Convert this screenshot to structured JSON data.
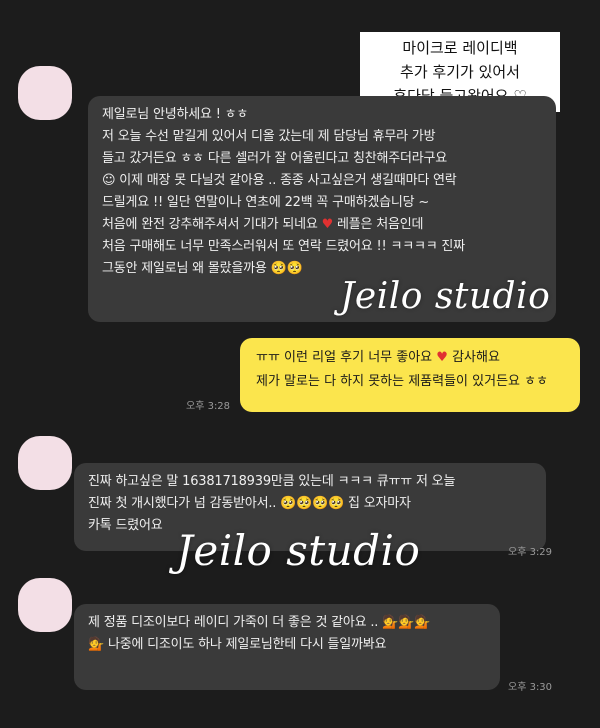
{
  "note": {
    "line1": "마이크로 레이디백",
    "line2": "추가 후기가 있어서",
    "line3": "후다닥 들고왔어요 ♡"
  },
  "watermark": "Jeilo studio",
  "messages": {
    "m1": {
      "line1": "제일로님 안녕하세요 ! ㅎㅎ",
      "line2": "저 오늘 수선 맡길게 있어서 디올 갔는데 제 담당님 휴무라 가방",
      "line3": "들고 갔거든요 ㅎㅎ 다른 셀러가 잘 어울린다고 칭찬해주더라구요",
      "line4": "☺ 이제 매장 못 다닐것 같아용 .. 종종 사고싶은거 생길때마다 연락",
      "line5": "드릴게요 !! 일단 연말이나 연초에 22백 꼭 구매하겠습니당 ~",
      "line6a": "처음에 완전 강추해주셔서 기대가 되네요",
      "line6b": "레플은 처음인데",
      "line7": "처음 구매해도 너무 만족스러워서 또 연락 드렸어요 !! ㅋㅋㅋㅋ 진짜",
      "line8": "그동안 제일로님 왜 몰랐을까용 🥺🥺",
      "time": "오후 3:28"
    },
    "m2": {
      "line1a": "ㅠㅠ 이런 리얼 후기 너무 좋아요",
      "line1b": "감사해요",
      "line2": "제가 말로는 다 하지 못하는 제품력들이 있거든요 ㅎㅎ",
      "time": "오후 3:28"
    },
    "m3": {
      "line1": "진짜 하고싶은 말 16381718939만큼 있는데 ㅋㅋㅋ 큐ㅠㅠ 저 오늘",
      "line2": "진짜 첫 개시했다가 넘 감동받아서.. 🥺🥺🥺🥺 집 오자마자",
      "line3": "카톡 드렸어요",
      "time": "오후 3:29"
    },
    "m4": {
      "line1": "제 정품 디조이보다 레이디 가죽이 더 좋은 것 같아요 ..",
      "line2": "나중에 디조이도 하나 제일로님한테 다시 들일까봐요",
      "time": "오후 3:30"
    }
  },
  "icons": {
    "heart": "♥",
    "smile": "☺",
    "person": "💁"
  },
  "colors": {
    "background": "#1c1c1c",
    "incoming_bubble": "#3a3a3a",
    "outgoing_bubble": "#fbe54d",
    "avatar": "#f3dfe6"
  }
}
